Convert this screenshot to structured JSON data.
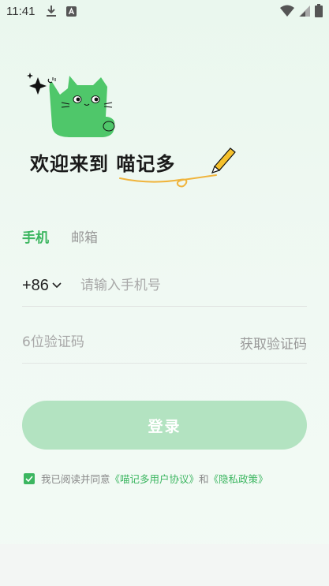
{
  "status_bar": {
    "time": "11:41"
  },
  "slogan": {
    "text": "欢迎来到 喵记多"
  },
  "tabs": [
    {
      "label": "手机",
      "active": true
    },
    {
      "label": "邮箱",
      "active": false
    }
  ],
  "phone": {
    "country_code": "+86",
    "placeholder": "请输入手机号",
    "value": ""
  },
  "verification": {
    "placeholder": "6位验证码",
    "value": "",
    "get_code_label": "获取验证码"
  },
  "login_button": {
    "label": "登录"
  },
  "agreement": {
    "checked": true,
    "prefix": "我已阅读并同意",
    "user_agreement": "《喵记多用户协议》",
    "and": "和",
    "privacy_policy": "《隐私政策》"
  },
  "colors": {
    "accent": "#3cb660",
    "button_disabled": "#b3e3c1",
    "cat_green": "#4fc76a"
  }
}
